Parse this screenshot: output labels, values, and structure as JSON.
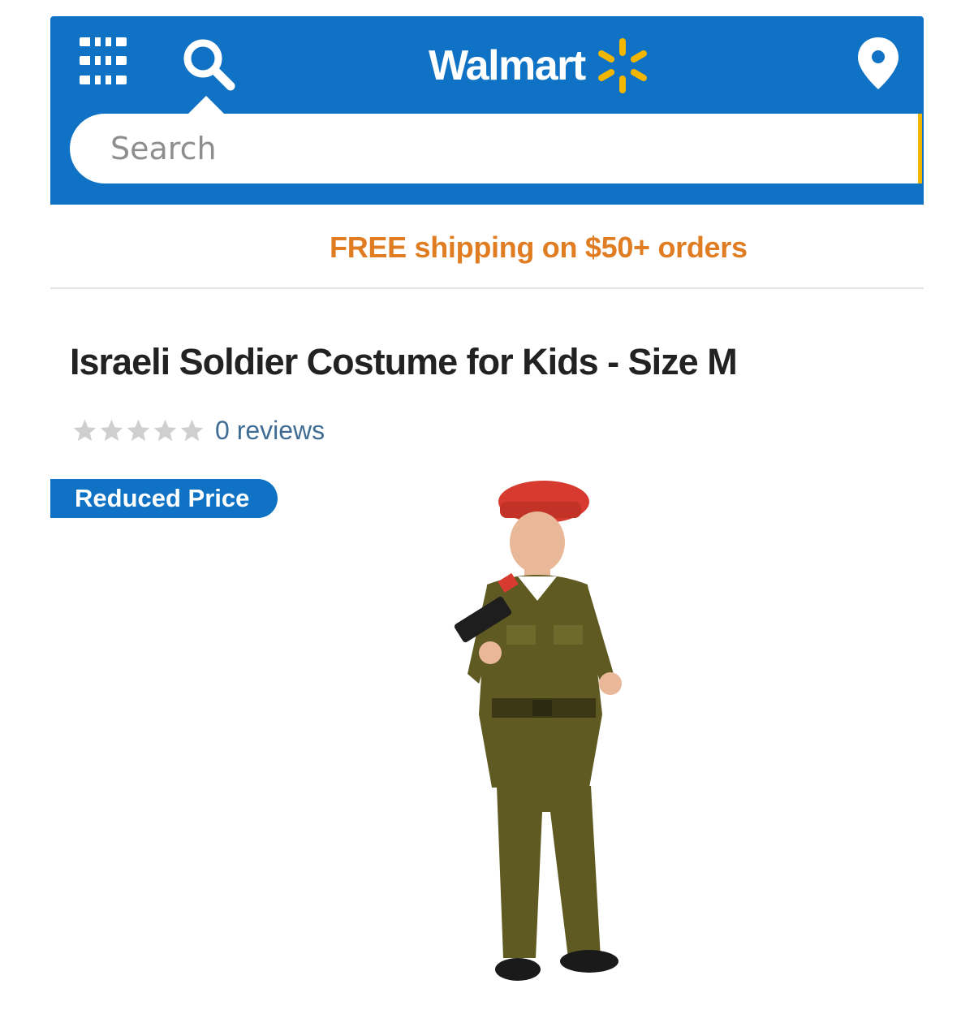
{
  "header": {
    "brand": "Walmart",
    "icons": [
      "menu-icon",
      "search-icon",
      "spark-icon",
      "location-icon"
    ],
    "background_color": "#0f72c4",
    "accent_color": "#f2b600"
  },
  "search": {
    "placeholder": "Search",
    "value": ""
  },
  "banner": {
    "shipping_text": "FREE shipping on $50+ orders",
    "color": "#e07d22"
  },
  "product": {
    "title": "Israeli Soldier Costume for Kids - Size M",
    "rating": {
      "stars": 0,
      "max_stars": 5,
      "reviews_text": "0 reviews"
    },
    "badge": "Reduced Price"
  }
}
